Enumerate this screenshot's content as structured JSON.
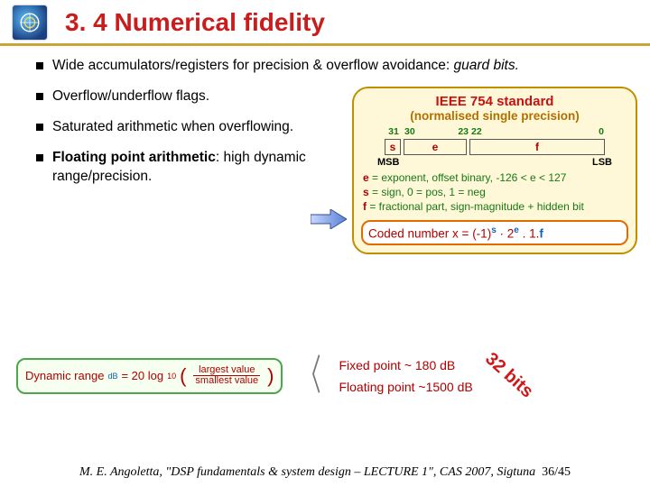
{
  "title": "3. 4 Numerical fidelity",
  "bullets": {
    "b1a": "Wide accumulators/registers for precision & overflow avoidance: ",
    "b1b": "guard bits.",
    "b2": "Overflow/underflow flags.",
    "b3": "Saturated arithmetic when overflowing.",
    "b4a": "Floating point arithmetic",
    "b4b": ": high dynamic range/precision."
  },
  "ieee": {
    "hdr1": "IEEE 754 standard",
    "hdr2": "(normalised single precision)",
    "n31": "31",
    "n30": "30",
    "n23": "23",
    "n22": "22",
    "n0": "0",
    "s": "s",
    "e": "e",
    "f": "f",
    "msb": "MSB",
    "lsb": "LSB",
    "rowE": " = exponent, offset binary, -126 < e < 127",
    "rowS": " = sign, 0 = pos, 1 = neg",
    "rowF": " = fractional part, sign-magnitude + hidden bit",
    "codedPrefix": "Coded number x = (-1)",
    "dot2": " · 2",
    "dot1f": " . 1.",
    "fsym": "f"
  },
  "dr": {
    "label": "Dynamic range",
    "sub": "dB",
    "eq": " = 20 log",
    "ten": "10",
    "num": "largest value",
    "den": "smallest value",
    "fixed": "Fixed point ~ 180 dB",
    "float": "Floating point ~1500 dB",
    "bits": "32 bits"
  },
  "footer": {
    "text": "M. E. Angoletta, \"DSP fundamentals & system design – LECTURE 1\", CAS 2007, Sigtuna",
    "page": "36/45"
  }
}
